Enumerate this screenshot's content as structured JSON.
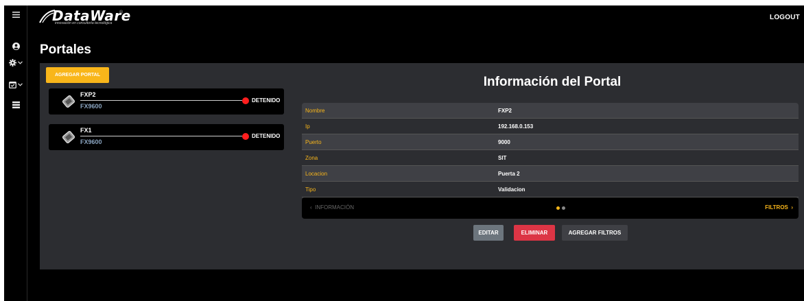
{
  "header": {
    "logo_text": "DataWare",
    "logo_tagline": "innovación en consultoría tecnológica",
    "logout_label": "LOGOUT"
  },
  "sidebar": {
    "items": [
      {
        "icon": "menu-icon"
      },
      {
        "icon": "user-circle-icon"
      },
      {
        "icon": "gear-icon"
      },
      {
        "icon": "calendar-check-icon"
      },
      {
        "icon": "list-icon"
      }
    ]
  },
  "page": {
    "title": "Portales"
  },
  "portals": {
    "add_label": "AGREGAR PORTAL",
    "items": [
      {
        "name": "FXP2",
        "model": "FX9600",
        "status": "DETENIDO"
      },
      {
        "name": "FX1",
        "model": "FX9600",
        "status": "DETENIDO"
      }
    ]
  },
  "info": {
    "title": "Información del Portal",
    "rows": [
      {
        "key": "Nombre",
        "value": "FXP2"
      },
      {
        "key": "Ip",
        "value": "192.168.0.153"
      },
      {
        "key": "Puerto",
        "value": "9000"
      },
      {
        "key": "Zona",
        "value": "SIT"
      },
      {
        "key": "Locacion",
        "value": "Puerta 2"
      },
      {
        "key": "Tipo",
        "value": "Validacion"
      }
    ]
  },
  "pager": {
    "prev_label": "INFORMACIÓN",
    "next_label": "FILTROS",
    "page_count": 2,
    "current_page": 1
  },
  "actions": {
    "edit_label": "EDITAR",
    "delete_label": "ELIMINAR",
    "add_filters_label": "AGREGAR FILTROS"
  },
  "colors": {
    "accent": "#f9b61a",
    "danger": "#dc3545",
    "status_stopped": "#ff1e1e",
    "panel": "#2c2d31"
  }
}
